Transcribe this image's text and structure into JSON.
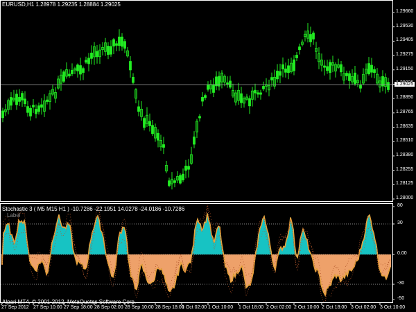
{
  "main_chart": {
    "symbol_header": "EURUSD,H1  1.28978 1.29235 1.28884 1.29025",
    "price_axis": [
      "1.29660",
      "1.29530",
      "1.29405",
      "1.29275",
      "1.29150",
      "1.29025",
      "1.28890",
      "1.28765",
      "1.28635",
      "1.28510",
      "1.28380",
      "1.28255",
      "1.28125",
      "1.28000"
    ],
    "current_price": "1.29025",
    "colors": {
      "candle": "#22ee22",
      "background": "#000000",
      "axis_text": "#ffffff",
      "price_line": "#9a9a9a"
    }
  },
  "sub_chart": {
    "header": "Stochastic 3 ( M5  M15  H1 ) -10.7286 -22.1951 14.0278 -24.0186 -10.7286",
    "label_text": "Label",
    "axis": [
      "80",
      "30",
      "0.00",
      "-30",
      "-50"
    ],
    "copyright": "Alpari MT4, © 2001-2012, MetaQuotes Software Corp.",
    "colors": {
      "positive": "#17c3c3",
      "negative": "#eea16a",
      "line": "#e6a23c",
      "dots": "#b2552a"
    }
  },
  "time_axis": [
    "27 Sep 2012",
    "27 Sep 10:00",
    "27 Sep 18:00",
    "28 Sep 02:00",
    "28 Sep 10:00",
    "28 Sep 18:00",
    "1 Oct 02:00",
    "1 Oct 10:00",
    "1 Oct 18:00",
    "2 Oct 02:00",
    "2 Oct 10:00",
    "2 Oct 18:00",
    "3 Oct 02:00",
    "3 Oct 10:00"
  ]
}
